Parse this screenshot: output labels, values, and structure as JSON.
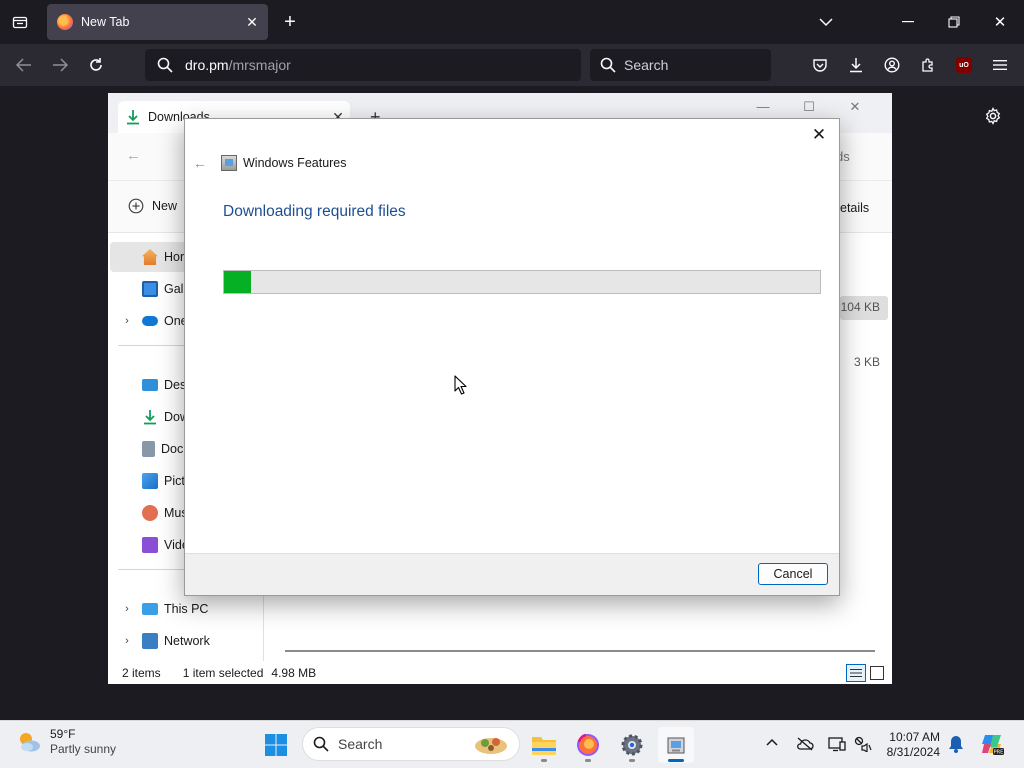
{
  "browser": {
    "tab_title": "New Tab",
    "url_host": "dro.pm",
    "url_path": "/mrsmajor",
    "search_placeholder": "Search"
  },
  "explorer": {
    "tab_title": "Downloads",
    "nav_partial": "ds",
    "new_label": "New",
    "details_label": "etails",
    "sidebar": [
      {
        "label": "Hor",
        "icon": "home-icon"
      },
      {
        "label": "Gall",
        "icon": "gallery-icon"
      },
      {
        "label": "One",
        "icon": "onedrive-icon"
      },
      {
        "label": "Desl",
        "icon": "desktop-icon"
      },
      {
        "label": "Dow",
        "icon": "downloads-icon"
      },
      {
        "label": "Doc",
        "icon": "documents-icon"
      },
      {
        "label": "Pict",
        "icon": "pictures-icon"
      },
      {
        "label": "Mus",
        "icon": "music-icon"
      },
      {
        "label": "Vide",
        "icon": "videos-icon"
      },
      {
        "label": "This PC",
        "icon": "this-pc-icon"
      },
      {
        "label": "Network",
        "icon": "network-icon"
      }
    ],
    "rows": [
      {
        "size": "104 KB"
      },
      {
        "size": "3 KB"
      }
    ],
    "status": {
      "items": "2 items",
      "selected": "1 item selected",
      "size": "4.98 MB"
    }
  },
  "dialog": {
    "title": "Windows Features",
    "heading": "Downloading required files",
    "progress_percent": 4.5,
    "cancel_label": "Cancel"
  },
  "taskbar": {
    "weather_temp": "59°F",
    "weather_cond": "Partly sunny",
    "search_placeholder": "Search",
    "time": "10:07 AM",
    "date": "8/31/2024"
  },
  "colors": {
    "progress_fill": "#06b025",
    "accent": "#0067c0",
    "heading_blue": "#1d4f91"
  }
}
